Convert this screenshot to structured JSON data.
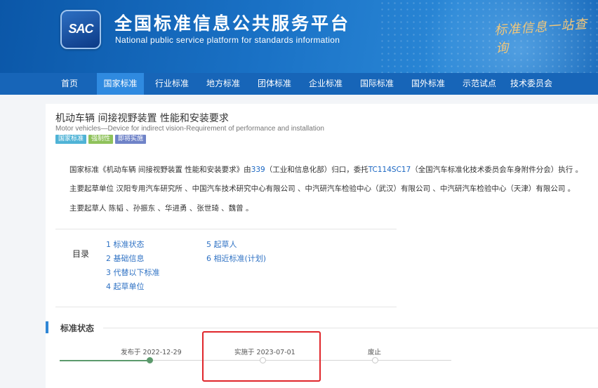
{
  "header": {
    "logo_text": "SAC",
    "title_cn": "全国标准信息公共服务平台",
    "title_en": "National public service platform  for standards information",
    "slogan": "标准信息一站查询"
  },
  "nav": {
    "items": [
      {
        "label": "首页"
      },
      {
        "label": "国家标准"
      },
      {
        "label": "行业标准"
      },
      {
        "label": "地方标准"
      },
      {
        "label": "团体标准"
      },
      {
        "label": "企业标准"
      },
      {
        "label": "国际标准"
      },
      {
        "label": "国外标准"
      },
      {
        "label": "示范试点"
      },
      {
        "label": "技术委员会"
      }
    ],
    "active": "国家标准"
  },
  "standard": {
    "title_cn": "机动车辆 间接视野装置 性能和安装要求",
    "title_en": "Motor vehicles—Device for indirect vision-Requirement of performance and installation",
    "badges": [
      {
        "label": "国家标准",
        "color": "#4fb3d6"
      },
      {
        "label": "强制性",
        "color": "#8fc25b"
      },
      {
        "label": "即将实施",
        "color": "#6f83c8"
      }
    ]
  },
  "description": {
    "line1_prefix": "国家标准《机动车辆 间接视野装置 性能和安装要求》由",
    "line1_link1": "339",
    "line1_mid": "（工业和信息化部）归口，委托",
    "line1_link2": "TC114SC17",
    "line1_suffix": "（全国汽车标准化技术委员会车身附件分会）执行 。",
    "line2": "主要起草单位 汉阳专用汽车研究所 、中国汽车技术研究中心有限公司 、中汽研汽车检验中心（武汉）有限公司 、中汽研汽车检验中心（天津）有限公司 。",
    "line3": "主要起草人 陈韬 、孙振东 、华进勇 、张世琦 、魏曾 。"
  },
  "toc": {
    "label": "目录",
    "items": [
      "1  标准状态",
      "2  基础信息",
      "3  代替以下标准",
      "4  起草单位",
      "5  起草人",
      "6  相近标准(计划)"
    ]
  },
  "status_section": {
    "title": "标准状态",
    "timeline": [
      {
        "label": "发布于 2022-12-29",
        "done": true
      },
      {
        "label": "实施于 2023-07-01",
        "done": false
      },
      {
        "label": "废止",
        "done": false
      }
    ]
  },
  "colors": {
    "nav_bg": "#1765b8",
    "nav_active": "#2f8ae0",
    "link": "#1a66c2",
    "timeline_done": "#5c9a6c",
    "highlight": "#e0262b"
  }
}
